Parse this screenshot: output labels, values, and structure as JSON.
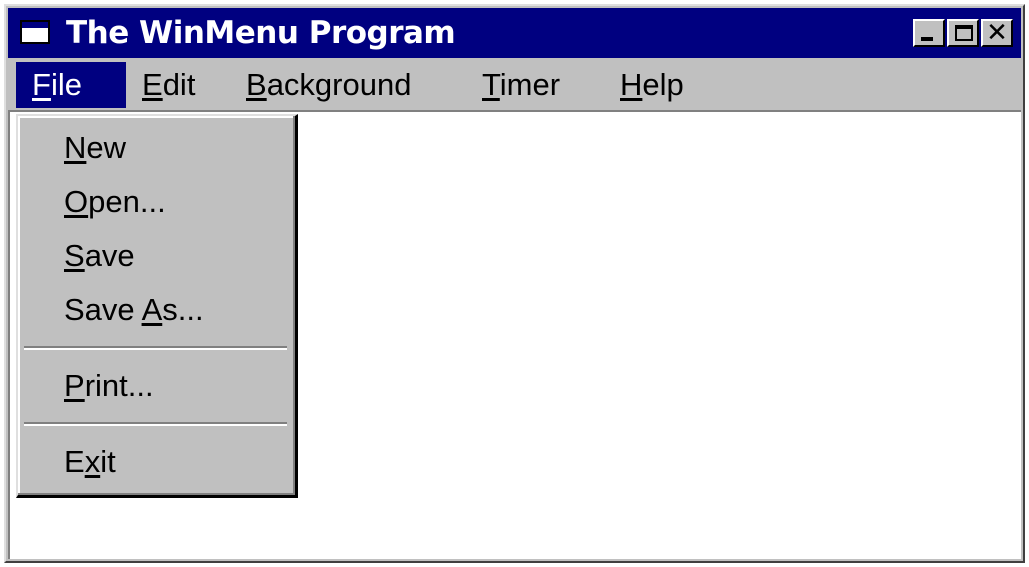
{
  "window": {
    "title": "The WinMenu Program",
    "controls": {
      "minimize": "minimize",
      "maximize": "maximize",
      "close": "✕"
    }
  },
  "menubar": {
    "items": [
      {
        "pre": "",
        "key": "F",
        "post": "ile"
      },
      {
        "pre": "",
        "key": "E",
        "post": "dit"
      },
      {
        "pre": "",
        "key": "B",
        "post": "ackground"
      },
      {
        "pre": "",
        "key": "T",
        "post": "imer"
      },
      {
        "pre": "",
        "key": "H",
        "post": "elp"
      }
    ],
    "active": "File"
  },
  "file_menu": {
    "items": [
      {
        "pre": "",
        "key": "N",
        "post": "ew"
      },
      {
        "pre": "",
        "key": "O",
        "post": "pen..."
      },
      {
        "pre": "",
        "key": "S",
        "post": "ave"
      },
      {
        "pre": "Save ",
        "key": "A",
        "post": "s..."
      },
      {
        "pre": "",
        "key": "P",
        "post": "rint..."
      },
      {
        "pre": "E",
        "key": "x",
        "post": "it"
      }
    ]
  },
  "colors": {
    "titlebar": "#000080",
    "face": "#c0c0c0",
    "client": "#ffffff",
    "highlight": "#000080"
  }
}
